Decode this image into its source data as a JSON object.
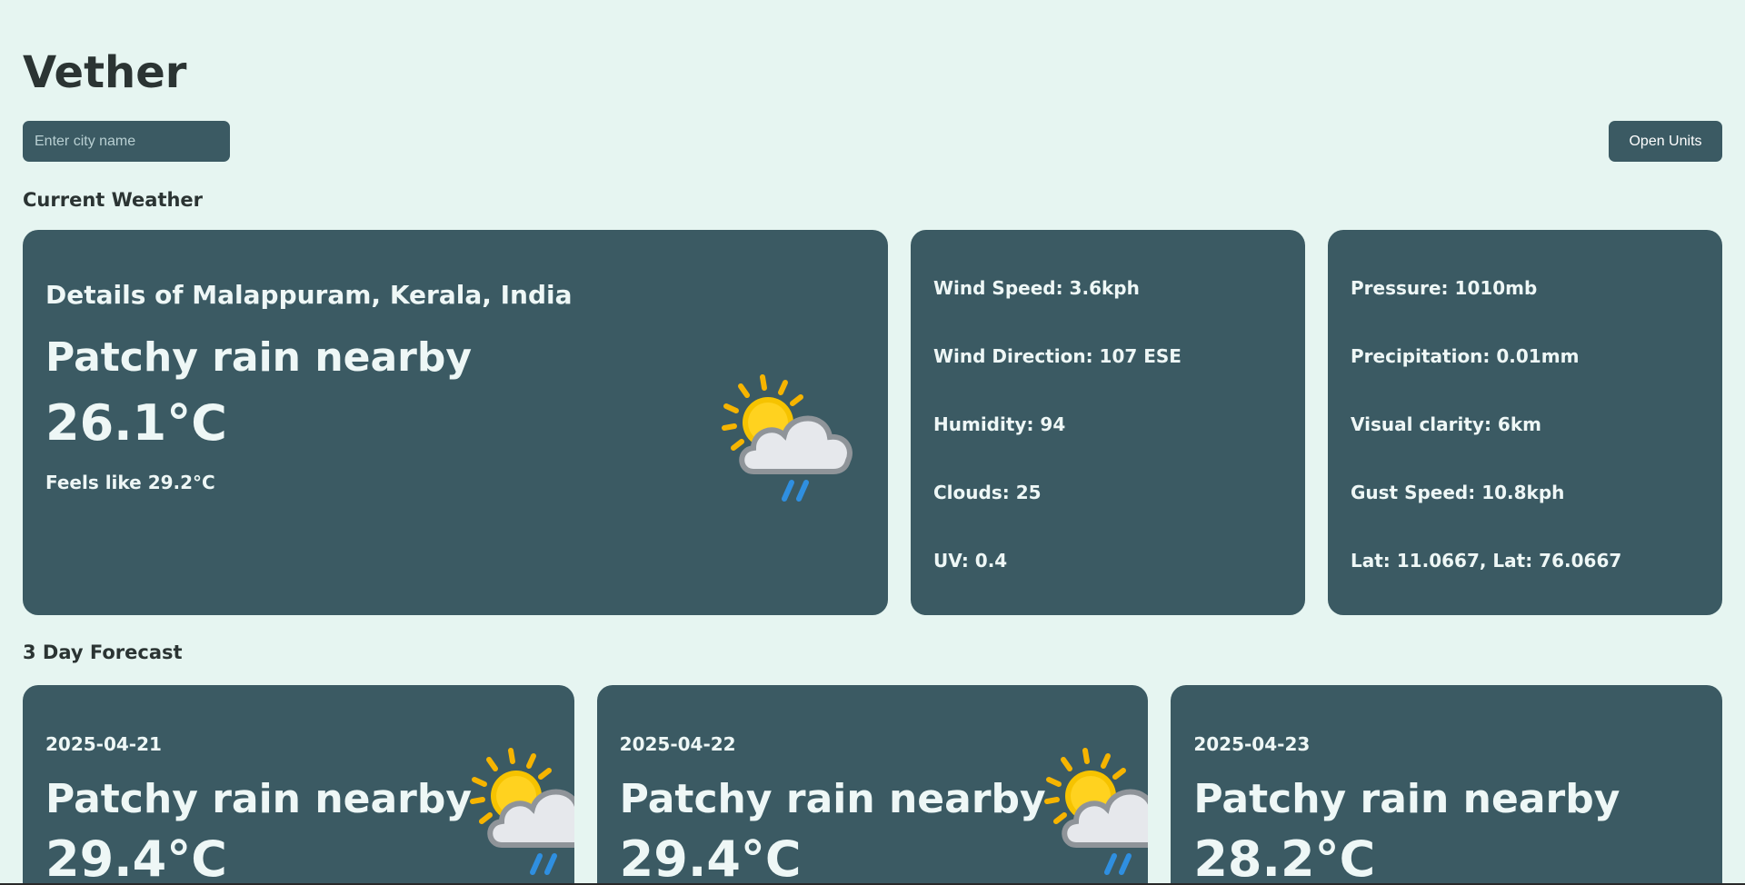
{
  "app": {
    "title": "Vether"
  },
  "search": {
    "placeholder": "Enter city name",
    "value": ""
  },
  "units_button": {
    "label": "Open Units"
  },
  "current": {
    "section_title": "Current Weather",
    "location": "Details of Malappuram, Kerala, India",
    "condition": "Patchy rain nearby",
    "temperature": "26.1°C",
    "feels_like": "Feels like 29.2°C",
    "icon": "patchy-rain-icon",
    "details_left": [
      "Wind Speed: 3.6kph",
      "Wind Direction: 107 ESE",
      "Humidity: 94",
      "Clouds: 25",
      "UV: 0.4"
    ],
    "details_right": [
      "Pressure: 1010mb",
      "Precipitation: 0.01mm",
      "Visual clarity: 6km",
      "Gust Speed: 10.8kph",
      "Lat: 11.0667, Lat: 76.0667"
    ]
  },
  "forecast": {
    "section_title": "3 Day Forecast",
    "days": [
      {
        "date": "2025-04-21",
        "condition": "Patchy rain nearby",
        "temperature": "29.4°C",
        "icon": "patchy-rain-icon"
      },
      {
        "date": "2025-04-22",
        "condition": "Patchy rain nearby",
        "temperature": "29.4°C",
        "icon": "patchy-rain-icon"
      },
      {
        "date": "2025-04-23",
        "condition": "Patchy rain nearby",
        "temperature": "28.2°C",
        "icon": "patchy-rain-icon"
      }
    ]
  },
  "colors": {
    "background": "#e6f5f1",
    "card": "#3b5a63",
    "card_text": "#eef7f6",
    "heading_text": "#2b3433"
  }
}
